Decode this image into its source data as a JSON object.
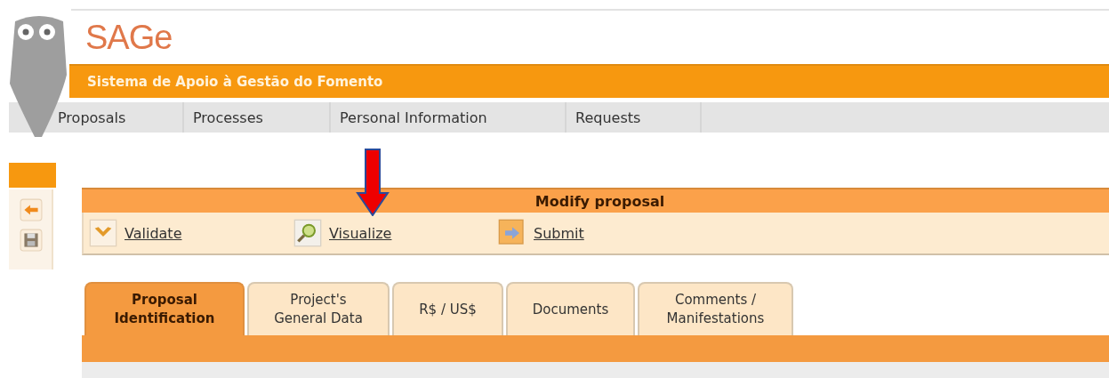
{
  "header": {
    "logo": "SAGe",
    "subtitle": "Sistema de Apoio à Gestão do Fomento"
  },
  "menu": [
    {
      "label": "Proposals"
    },
    {
      "label": "Processes"
    },
    {
      "label": "Personal Information"
    },
    {
      "label": "Requests"
    }
  ],
  "side_tools": [
    {
      "kind": "back"
    },
    {
      "kind": "save"
    }
  ],
  "panel": {
    "title": "Modify proposal",
    "actions": [
      {
        "kind": "validate",
        "label": "Validate"
      },
      {
        "kind": "visualize",
        "label": "Visualize"
      },
      {
        "kind": "submit",
        "label": "Submit"
      }
    ]
  },
  "tabs": [
    {
      "label": "Proposal\nIdentification",
      "selected": true
    },
    {
      "label": "Project's\nGeneral Data",
      "selected": false
    },
    {
      "label": "R$ / US$",
      "selected": false
    },
    {
      "label": "Documents",
      "selected": false
    },
    {
      "label": "Comments /\nManifestations",
      "selected": false
    }
  ]
}
